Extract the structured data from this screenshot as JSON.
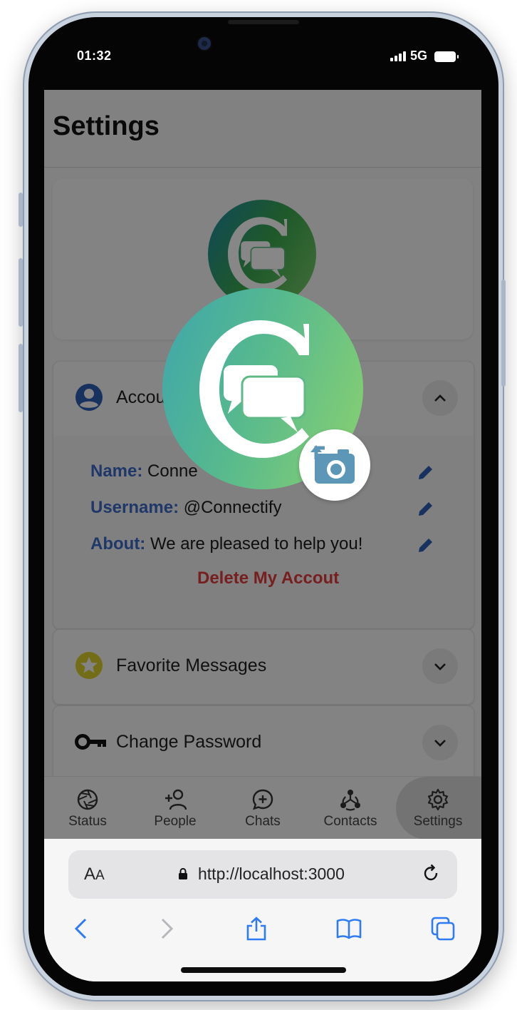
{
  "status_bar": {
    "time": "01:32",
    "network": "5G"
  },
  "page": {
    "title": "Settings"
  },
  "account": {
    "title": "Accou",
    "fields": [
      {
        "key": "Name:",
        "value": "Conne"
      },
      {
        "key": "Username:",
        "value": "@Connectify"
      },
      {
        "key": "About:",
        "value": "We are pleased to help you!"
      }
    ],
    "delete_label": "Delete My Accout"
  },
  "favorites": {
    "title": "Favorite Messages"
  },
  "password": {
    "title": "Change Password"
  },
  "nav": {
    "items": [
      {
        "label": "Status",
        "icon": "aperture-icon"
      },
      {
        "label": "People",
        "icon": "add-person-icon"
      },
      {
        "label": "Chats",
        "icon": "chat-plus-icon"
      },
      {
        "label": "Contacts",
        "icon": "contacts-icon"
      },
      {
        "label": "Settings",
        "icon": "gear-icon"
      }
    ],
    "active": "Settings"
  },
  "browser": {
    "aa_big": "A",
    "aa_small": "A",
    "url": "http://localhost:3000"
  },
  "colors": {
    "accent_blue": "#3b6bc6",
    "delete_red": "#e03a3a",
    "star_yellow": "#d9cf2f",
    "logo_gradient_start": "#3fa6ac",
    "logo_gradient_end": "#8bd170"
  }
}
